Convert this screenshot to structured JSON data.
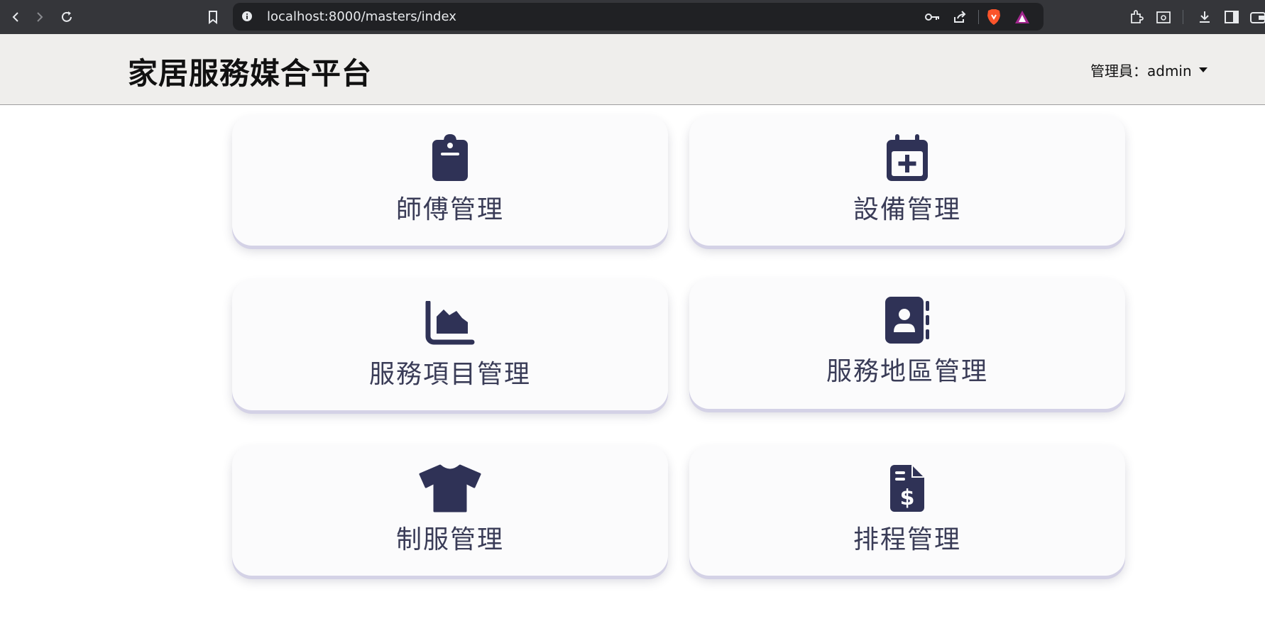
{
  "browser": {
    "url": "localhost:8000/masters/index"
  },
  "header": {
    "brand": "家居服務媒合平台",
    "admin_label": "管理員：admin"
  },
  "cards": [
    {
      "label": "師傅管理",
      "icon": "clipboard-icon"
    },
    {
      "label": "設備管理",
      "icon": "calendar-plus-icon"
    },
    {
      "label": "服務項目管理",
      "icon": "area-chart-icon"
    },
    {
      "label": "服務地區管理",
      "icon": "address-book-icon"
    },
    {
      "label": "制服管理",
      "icon": "shirt-icon"
    },
    {
      "label": "排程管理",
      "icon": "invoice-dollar-icon"
    }
  ],
  "colors": {
    "chrome": "#35363a",
    "urlbar": "#202124",
    "header_bg": "#efeeec",
    "icon": "#2f3256",
    "card_bg": "#fbfbfc",
    "card_shadow": "#d4d2e6"
  }
}
